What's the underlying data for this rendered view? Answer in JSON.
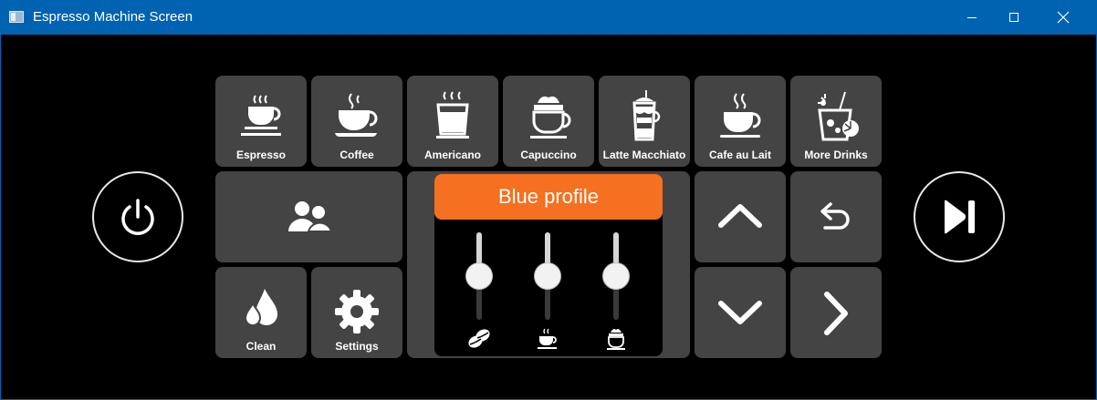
{
  "window": {
    "title": "Espresso Machine Screen",
    "accent_color": "#0063b1",
    "controls": [
      "minimize-icon",
      "maximize-icon",
      "close-icon"
    ]
  },
  "drinks": [
    {
      "label": "Espresso",
      "icon": "espresso-cup-icon"
    },
    {
      "label": "Coffee",
      "icon": "coffee-cup-icon"
    },
    {
      "label": "Americano",
      "icon": "americano-glass-icon"
    },
    {
      "label": "Capuccino",
      "icon": "cappuccino-cup-icon"
    },
    {
      "label": "Latte Macchiato",
      "icon": "latte-glass-icon"
    },
    {
      "label": "Cafe au Lait",
      "icon": "cafe-au-lait-cup-icon"
    },
    {
      "label": "More Drinks",
      "icon": "cocktail-icon"
    }
  ],
  "actions": {
    "profiles_icon": "users-icon",
    "clean": {
      "label": "Clean",
      "icon": "water-drops-icon"
    },
    "settings": {
      "label": "Settings",
      "icon": "gear-icon"
    }
  },
  "profile": {
    "name": "Blue profile",
    "header_color": "#f57020",
    "sliders": [
      {
        "icon": "coffee-beans-icon",
        "level": 0.5
      },
      {
        "icon": "small-cup-icon",
        "level": 0.5
      },
      {
        "icon": "latte-cup-icon",
        "level": 0.5
      }
    ]
  },
  "navigation": [
    "up-arrow-icon",
    "back-icon",
    "down-arrow-icon",
    "right-arrow-icon"
  ],
  "round_buttons": [
    "power-icon",
    "play-next-icon"
  ]
}
